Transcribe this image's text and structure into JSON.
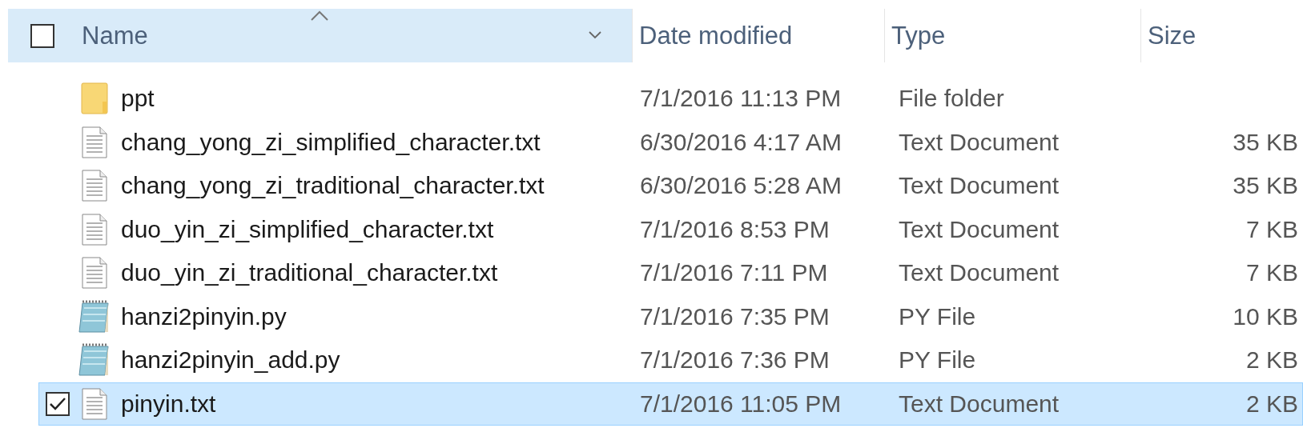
{
  "header": {
    "checkbox_checked": false,
    "columns": [
      {
        "label": "Name",
        "sorted_ascending": true,
        "hovered": true
      },
      {
        "label": "Date modified",
        "sorted_ascending": false,
        "hovered": false
      },
      {
        "label": "Type",
        "sorted_ascending": false,
        "hovered": false
      },
      {
        "label": "Size",
        "sorted_ascending": false,
        "hovered": false
      }
    ]
  },
  "rows": [
    {
      "kind": "folder",
      "name": "ppt",
      "date": "7/1/2016 11:13 PM",
      "type": "File folder",
      "selected": false,
      "checked": false
    },
    {
      "kind": "text",
      "name": "chang_yong_zi_simplified_character.txt",
      "date": "6/30/2016 4:17 AM",
      "type": "Text Document",
      "size": "35 KB",
      "selected": false,
      "checked": false
    },
    {
      "kind": "text",
      "name": "chang_yong_zi_traditional_character.txt",
      "date": "6/30/2016 5:28 AM",
      "type": "Text Document",
      "size": "35 KB",
      "selected": false,
      "checked": false
    },
    {
      "kind": "text",
      "name": "duo_yin_zi_simplified_character.txt",
      "date": "7/1/2016 8:53 PM",
      "type": "Text Document",
      "size": "7 KB",
      "selected": false,
      "checked": false
    },
    {
      "kind": "text",
      "name": "duo_yin_zi_traditional_character.txt",
      "date": "7/1/2016 7:11 PM",
      "type": "Text Document",
      "size": "7 KB",
      "selected": false,
      "checked": false
    },
    {
      "kind": "python",
      "name": "hanzi2pinyin.py",
      "date": "7/1/2016 7:35 PM",
      "type": "PY File",
      "size": "10 KB",
      "selected": false,
      "checked": false
    },
    {
      "kind": "python",
      "name": "hanzi2pinyin_add.py",
      "date": "7/1/2016 7:36 PM",
      "type": "PY File",
      "size": "2 KB",
      "selected": false,
      "checked": false
    },
    {
      "kind": "text",
      "name": "pinyin.txt",
      "date": "7/1/2016 11:05 PM",
      "type": "Text Document",
      "size": "2 KB",
      "selected": true,
      "checked": true
    }
  ]
}
